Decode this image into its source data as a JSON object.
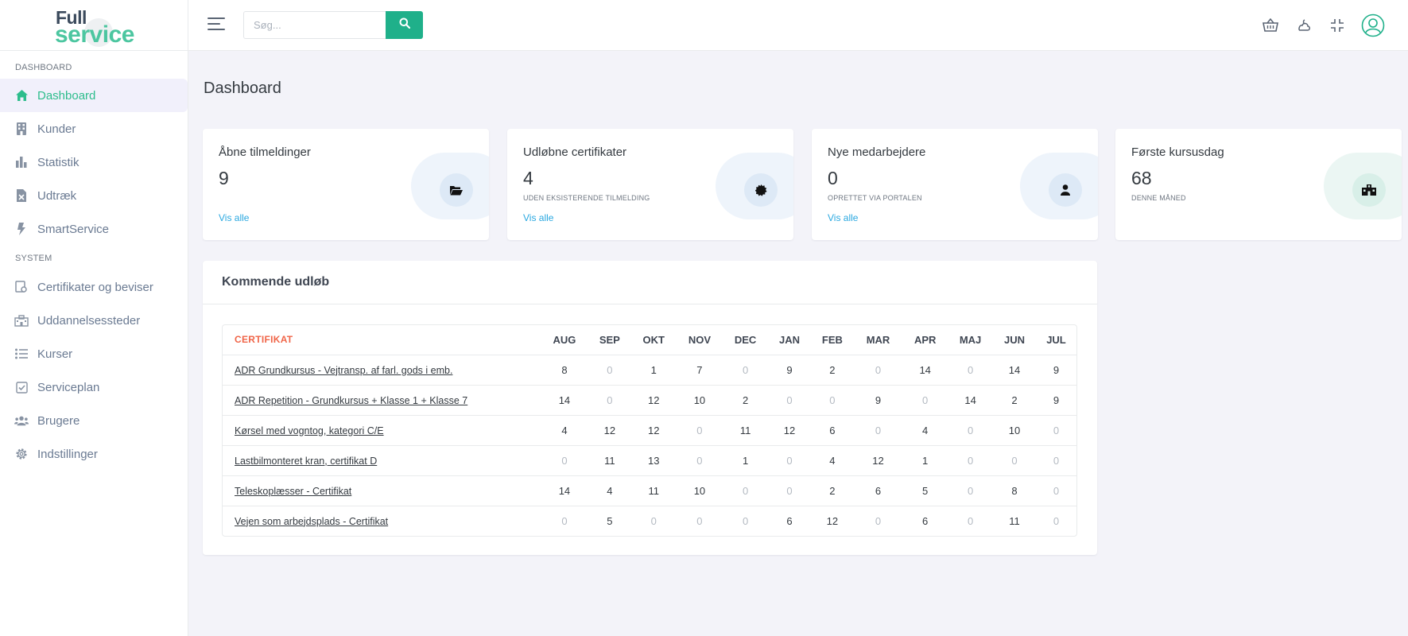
{
  "logo": {
    "line1": "Full",
    "line2": "service"
  },
  "sidebar": {
    "section1": "DASHBOARD",
    "section2": "SYSTEM",
    "items": [
      {
        "label": "Dashboard",
        "icon": "home-icon",
        "active": true
      },
      {
        "label": "Kunder",
        "icon": "building-icon"
      },
      {
        "label": "Statistik",
        "icon": "bar-chart-icon"
      },
      {
        "label": "Udtræk",
        "icon": "file-excel-icon"
      },
      {
        "label": "SmartService",
        "icon": "bolt-icon"
      },
      {
        "label": "Certifikater og beviser",
        "icon": "certificate-icon"
      },
      {
        "label": "Uddannelsessteder",
        "icon": "school-icon"
      },
      {
        "label": "Kurser",
        "icon": "list-icon"
      },
      {
        "label": "Serviceplan",
        "icon": "check-square-icon"
      },
      {
        "label": "Brugere",
        "icon": "users-icon"
      },
      {
        "label": "Indstillinger",
        "icon": "gear-icon"
      }
    ]
  },
  "topbar": {
    "search_placeholder": "Søg...",
    "icons": [
      "basket-icon",
      "weather-icon",
      "compress-icon",
      "user-avatar-icon"
    ]
  },
  "page": {
    "title": "Dashboard"
  },
  "cards": [
    {
      "title": "Åbne tilmeldinger",
      "value": "9",
      "subtitle": "",
      "link": "Vis alle",
      "icon": "folder-open-icon"
    },
    {
      "title": "Udløbne certifikater",
      "value": "4",
      "subtitle": "UDEN EKSISTERENDE TILMELDING",
      "link": "Vis alle",
      "icon": "badge-icon"
    },
    {
      "title": "Nye medarbejdere",
      "value": "0",
      "subtitle": "OPRETTET VIA PORTALEN",
      "link": "Vis alle",
      "icon": "user-icon"
    },
    {
      "title": "Første kursusdag",
      "value": "68",
      "subtitle": "DENNE MÅNED",
      "link": "",
      "icon": "school-icon"
    }
  ],
  "expiry": {
    "title": "Kommende udløb",
    "col_header": "CERTIFIKAT",
    "months": [
      "AUG",
      "SEP",
      "OKT",
      "NOV",
      "DEC",
      "JAN",
      "FEB",
      "MAR",
      "APR",
      "MAJ",
      "JUN",
      "JUL"
    ],
    "rows": [
      {
        "name": "ADR Grundkursus - Vejtransp. af farl. gods i emb.",
        "values": [
          8,
          0,
          1,
          7,
          0,
          9,
          2,
          0,
          14,
          0,
          14,
          9
        ]
      },
      {
        "name": "ADR Repetition - Grundkursus + Klasse 1 + Klasse 7",
        "values": [
          14,
          0,
          12,
          10,
          2,
          0,
          0,
          9,
          0,
          14,
          2,
          9
        ]
      },
      {
        "name": "Kørsel med vogntog, kategori C/E",
        "values": [
          4,
          12,
          12,
          0,
          11,
          12,
          6,
          0,
          4,
          0,
          10,
          0
        ]
      },
      {
        "name": "Lastbilmonteret kran, certifikat D",
        "values": [
          0,
          11,
          13,
          0,
          1,
          0,
          4,
          12,
          1,
          0,
          0,
          0
        ]
      },
      {
        "name": "Teleskoplæsser - Certifikat",
        "values": [
          14,
          4,
          11,
          10,
          0,
          0,
          2,
          6,
          5,
          0,
          8,
          0
        ]
      },
      {
        "name": "Vejen som arbejdsplads - Certifikat",
        "values": [
          0,
          5,
          0,
          0,
          0,
          6,
          12,
          0,
          6,
          0,
          11,
          0
        ]
      }
    ]
  },
  "colors": {
    "accent": "#1fb08a",
    "active_text": "#2dbd8c",
    "link": "#2aa8e0",
    "cert_header": "#f06548"
  }
}
